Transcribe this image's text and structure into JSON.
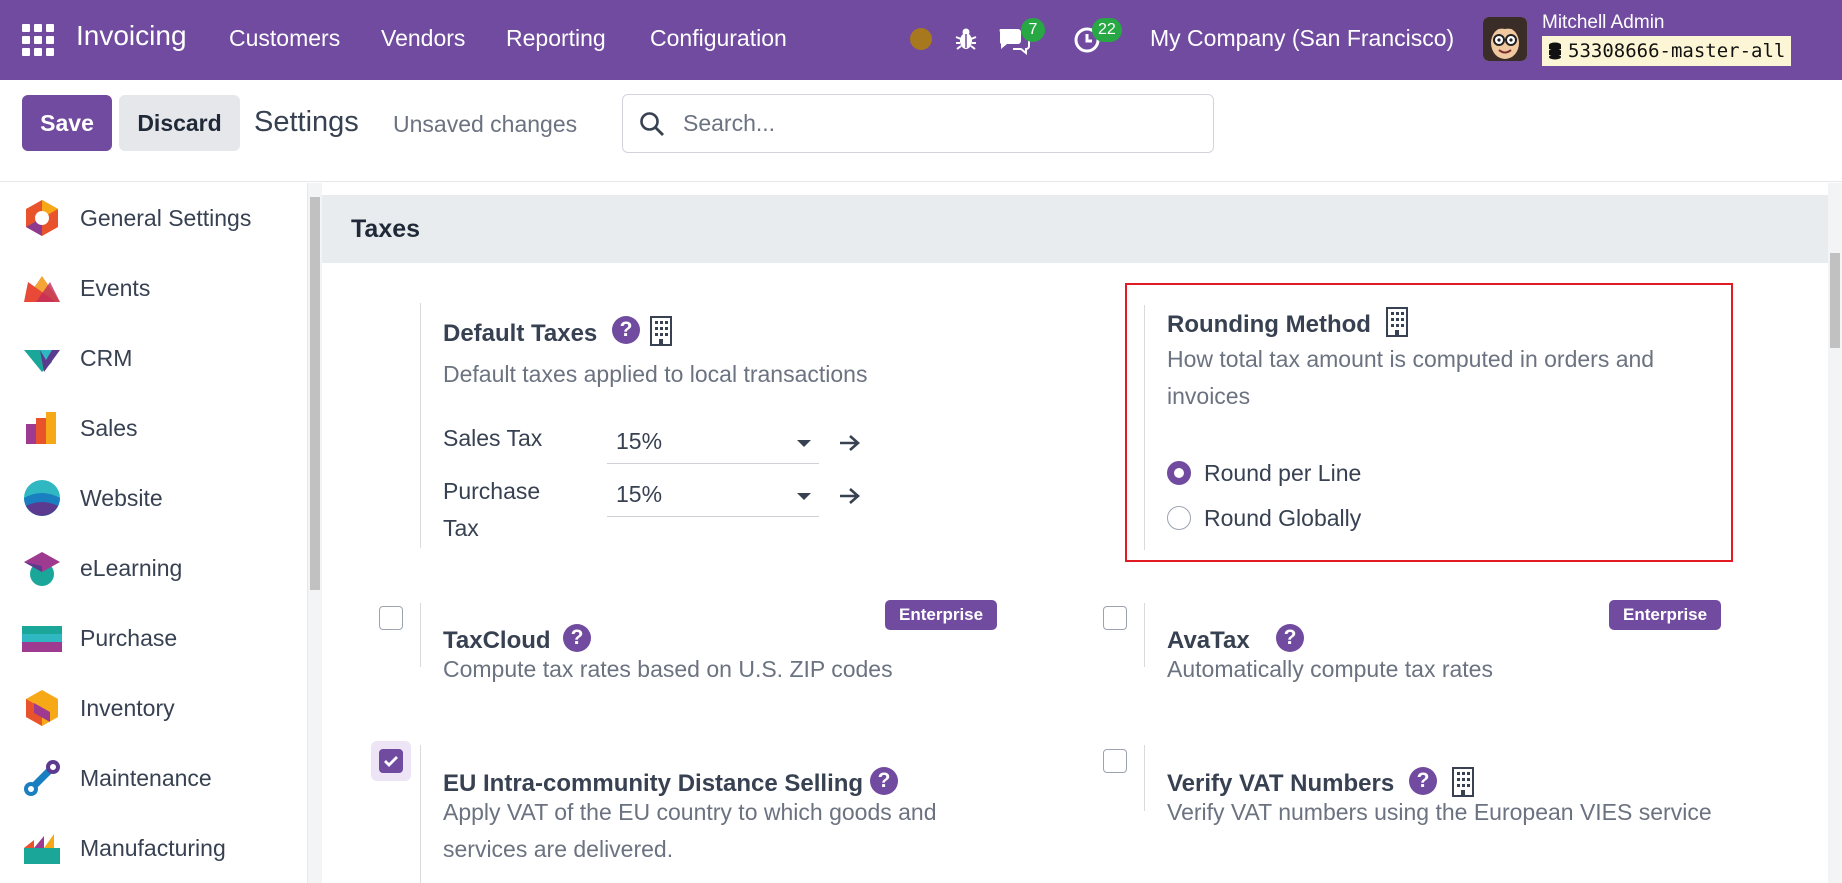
{
  "navbar": {
    "app_name": "Invoicing",
    "menu": [
      "Customers",
      "Vendors",
      "Reporting",
      "Configuration"
    ],
    "messages_count": "7",
    "activities_count": "22",
    "company": "My Company (San Francisco)",
    "user_name": "Mitchell Admin",
    "database": "53308666-master-all",
    "colors": {
      "bar": "#714b9f",
      "badge": "#28a745"
    }
  },
  "control": {
    "save_label": "Save",
    "discard_label": "Discard",
    "title": "Settings",
    "status": "Unsaved changes",
    "search_placeholder": "Search..."
  },
  "sidebar": {
    "items": [
      {
        "label": "General Settings",
        "icon": "general-settings-icon"
      },
      {
        "label": "Events",
        "icon": "events-icon"
      },
      {
        "label": "CRM",
        "icon": "crm-icon"
      },
      {
        "label": "Sales",
        "icon": "sales-icon"
      },
      {
        "label": "Website",
        "icon": "website-icon"
      },
      {
        "label": "eLearning",
        "icon": "elearning-icon"
      },
      {
        "label": "Purchase",
        "icon": "purchase-icon"
      },
      {
        "label": "Inventory",
        "icon": "inventory-icon"
      },
      {
        "label": "Maintenance",
        "icon": "maintenance-icon"
      },
      {
        "label": "Manufacturing",
        "icon": "manufacturing-icon"
      }
    ]
  },
  "taxes": {
    "section_title": "Taxes",
    "default_taxes": {
      "title": "Default Taxes",
      "description": "Default taxes applied to local transactions",
      "sales_tax_label": "Sales Tax",
      "sales_tax_value": "15%",
      "purchase_tax_label_line1": "Purchase",
      "purchase_tax_label_line2": "Tax",
      "purchase_tax_value": "15%"
    },
    "rounding": {
      "title": "Rounding Method",
      "description_line1": "How total tax amount is computed in orders and",
      "description_line2": "invoices",
      "options": [
        {
          "label": "Round per Line",
          "selected": true
        },
        {
          "label": "Round Globally",
          "selected": false
        }
      ]
    },
    "taxcloud": {
      "title": "TaxCloud",
      "description": "Compute tax rates based on U.S. ZIP codes",
      "badge": "Enterprise",
      "checked": false
    },
    "avatax": {
      "title": "AvaTax",
      "description": "Automatically compute tax rates",
      "badge": "Enterprise",
      "checked": false
    },
    "eu_distance": {
      "title": "EU Intra-community Distance Selling",
      "description_line1": "Apply VAT of the EU country to which goods and",
      "description_line2": "services are delivered.",
      "checked": true
    },
    "vat_verify": {
      "title": "Verify VAT Numbers",
      "description": "Verify VAT numbers using the European VIES service",
      "checked": false
    }
  }
}
